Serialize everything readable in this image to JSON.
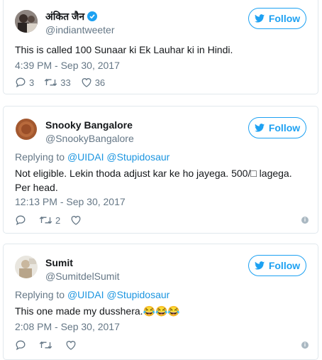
{
  "tweets": [
    {
      "name": "अंकित जैन",
      "handle": "@indiantweeter",
      "verified": true,
      "follow_label": "Follow",
      "text": "This is called 100 Sunaar ki Ek Lauhar ki in Hindi.",
      "timestamp": "4:39 PM - Sep 30, 2017",
      "replies": "3",
      "retweets": "33",
      "likes": "36"
    },
    {
      "name": "Snooky Bangalore",
      "handle": "@SnookyBangalore",
      "follow_label": "Follow",
      "replying_prefix": "Replying to",
      "replying_to": "@UIDAI @Stupidosaur",
      "text": "Not eligible. Lekin thoda adjust kar ke ho jayega. 500/□ lagega. Per head.",
      "timestamp": "12:13 PM - Sep 30, 2017",
      "replies": "",
      "retweets": "2",
      "likes": ""
    },
    {
      "name": "Sumit",
      "handle": "@SumitdelSumit",
      "follow_label": "Follow",
      "replying_prefix": "Replying to",
      "replying_to": "@UIDAI @Stupidosaur",
      "text": "This one made my dusshera.😂😂😂",
      "timestamp": "2:08 PM - Sep 30, 2017",
      "replies": "",
      "retweets": "",
      "likes": ""
    }
  ],
  "colors": {
    "accent": "#1da1f2",
    "secondary_text": "#657786",
    "border": "#e1e8ed",
    "link": "#1b95e0"
  },
  "icons": [
    "verified-badge-icon",
    "twitter-bird-icon",
    "reply-icon",
    "retweet-icon",
    "heart-icon",
    "info-icon"
  ]
}
